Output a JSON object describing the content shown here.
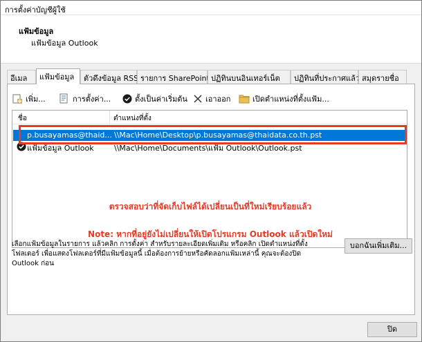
{
  "window": {
    "title": "การตั้งค่าบัญชีผู้ใช้"
  },
  "header": {
    "title": "แฟ้มข้อมูล",
    "subtitle": "แฟ้มข้อมูล Outlook"
  },
  "tabs": [
    {
      "label": "อีเมล",
      "active": false
    },
    {
      "label": "แฟ้มข้อมูล",
      "active": true
    },
    {
      "label": "ตัวดึงข้อมูล RSS",
      "active": false
    },
    {
      "label": "รายการ SharePoint",
      "active": false
    },
    {
      "label": "ปฏิทินบนอินเทอร์เน็ต",
      "active": false
    },
    {
      "label": "ปฏิทินที่ประกาศแล้ว",
      "active": false
    },
    {
      "label": "สมุดรายชื่อ",
      "active": false
    }
  ],
  "toolbar": {
    "add_label": "เพิ่ม...",
    "settings_label": "การตั้งค่า...",
    "default_label": "ตั้งเป็นค่าเริ่มต้น",
    "remove_label": "เอาออก",
    "open_location_label": "เปิดตำแหน่งที่ตั้งแฟ้ม..."
  },
  "list": {
    "col_name": "ชื่อ",
    "col_location": "ตำแหน่งที่ตั้ง",
    "rows": [
      {
        "name": "p.busayamas@thaid...",
        "location": "\\\\Mac\\Home\\Desktop\\p.busayamas@thaidata.co.th.pst",
        "selected": true,
        "default": false
      },
      {
        "name": "แฟ้มข้อมูล Outlook",
        "location": "\\\\Mac\\Home\\Documents\\แฟ้ม Outlook\\Outlook.pst",
        "selected": false,
        "default": true
      }
    ]
  },
  "annotations": {
    "note1": "ตรวจสอบว่าที่จัดเก็บไฟล์ได้เปลี่ยนเป็นที่ใหม่เรียบร้อยแล้ว",
    "note2": "Note: หากที่อยู่ยังไม่เปลี่ยนให้เปิดโปรแกรม Outlook แล้วเปิดใหม่",
    "color": "#e53a24"
  },
  "description": {
    "line1": "เลือกแฟ้มข้อมูลในรายการ แล้วคลิก การตั้งค่า สำหรับรายละเอียดเพิ่มเติม หรือคลิก เปิดตำแหน่งที่ตั้ง",
    "line2": "โฟลเดอร์ เพื่อแสดงโฟลเดอร์ที่มีแฟ้มข้อมูลนี้ เมื่อต้องการย้ายหรือคัดลอกแฟ้มเหล่านี้ คุณจะต้องปิด",
    "line3": "Outlook ก่อน"
  },
  "buttons": {
    "tell_more": "บอกฉันเพิ่มเติม...",
    "close": "ปิด"
  },
  "colors": {
    "selection": "#0078d7",
    "highlight": "#e53a24"
  }
}
